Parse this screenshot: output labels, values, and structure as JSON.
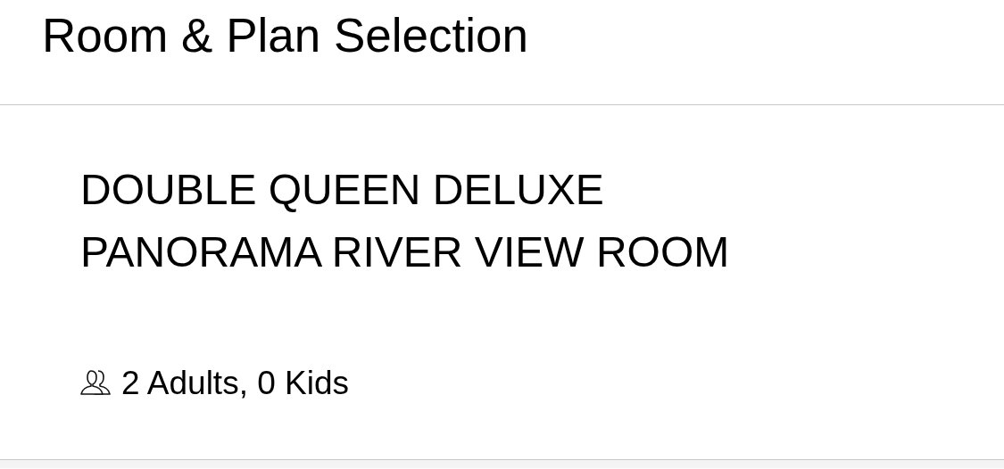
{
  "header": {
    "title": "Room & Plan Selection"
  },
  "room": {
    "name": "DOUBLE QUEEN DELUXE PANORAMA RIVER VIEW ROOM",
    "guests": "2 Adults, 0 Kids"
  }
}
